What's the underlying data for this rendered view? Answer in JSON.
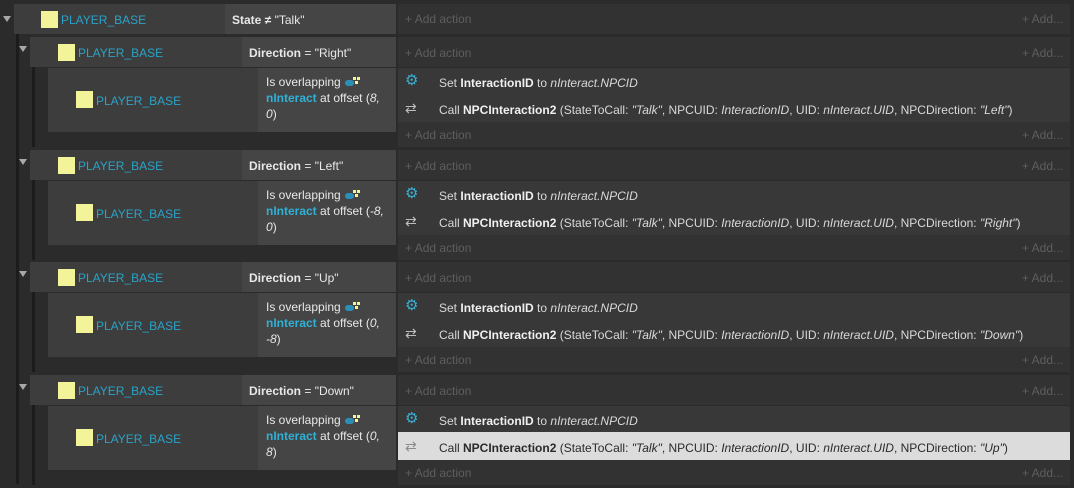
{
  "top": {
    "object": "PLAYER_BASE",
    "cond_prefix": "State ≠ ",
    "cond_value": "\"Talk\"",
    "add_action": "Add action",
    "add_right": "Add..."
  },
  "blocks": [
    {
      "object": "PLAYER_BASE",
      "dir_label": "Direction",
      "dir_value": "= \"Right\"",
      "sub_object": "PLAYER_BASE",
      "cond_l1": "Is overlapping",
      "cond_obj": "nInteract",
      "cond_l2a": " at offset (",
      "cond_l2b": "8,",
      "cond_l3": "0",
      "cond_l3end": ")",
      "a1_pre": "Set ",
      "a1_bold": "InteractionID",
      "a1_mid": " to ",
      "a1_ital": "nInteract.NPCID",
      "a2_pre": "Call ",
      "a2_bold": "NPCInteraction2",
      "a2_p1": " (StateToCall: ",
      "a2_i1": "\"Talk\"",
      "a2_p2": ", NPCUID: ",
      "a2_i2": "InteractionID",
      "a2_p3": ", UID: ",
      "a2_i3": "nInteract.UID",
      "a2_p4": ", NPCDirection: ",
      "a2_i4": "\"Left\"",
      "a2_p5": ")",
      "add_action": "Add action",
      "add_right": "Add..."
    },
    {
      "object": "PLAYER_BASE",
      "dir_label": "Direction",
      "dir_value": "= \"Left\"",
      "sub_object": "PLAYER_BASE",
      "cond_l1": "Is overlapping",
      "cond_obj": "nInteract",
      "cond_l2a": " at offset (",
      "cond_l2b": "-8,",
      "cond_l3": "0",
      "cond_l3end": ")",
      "a1_pre": "Set ",
      "a1_bold": "InteractionID",
      "a1_mid": " to ",
      "a1_ital": "nInteract.NPCID",
      "a2_pre": "Call ",
      "a2_bold": "NPCInteraction2",
      "a2_p1": " (StateToCall: ",
      "a2_i1": "\"Talk\"",
      "a2_p2": ", NPCUID: ",
      "a2_i2": "InteractionID",
      "a2_p3": ", UID: ",
      "a2_i3": "nInteract.UID",
      "a2_p4": ", NPCDirection: ",
      "a2_i4": "\"Right\"",
      "a2_p5": ")",
      "add_action": "Add action",
      "add_right": "Add..."
    },
    {
      "object": "PLAYER_BASE",
      "dir_label": "Direction",
      "dir_value": "= \"Up\"",
      "sub_object": "PLAYER_BASE",
      "cond_l1": "Is overlapping",
      "cond_obj": "nInteract",
      "cond_l2a": " at offset (",
      "cond_l2b": "0,",
      "cond_l3": "-8",
      "cond_l3end": ")",
      "a1_pre": "Set ",
      "a1_bold": "InteractionID",
      "a1_mid": " to ",
      "a1_ital": "nInteract.NPCID",
      "a2_pre": "Call ",
      "a2_bold": "NPCInteraction2",
      "a2_p1": " (StateToCall: ",
      "a2_i1": "\"Talk\"",
      "a2_p2": ", NPCUID: ",
      "a2_i2": "InteractionID",
      "a2_p3": ", UID: ",
      "a2_i3": "nInteract.UID",
      "a2_p4": ", NPCDirection: ",
      "a2_i4": "\"Down\"",
      "a2_p5": ")",
      "add_action": "Add action",
      "add_right": "Add..."
    },
    {
      "object": "PLAYER_BASE",
      "dir_label": "Direction",
      "dir_value": "= \"Down\"",
      "sub_object": "PLAYER_BASE",
      "cond_l1": "Is overlapping",
      "cond_obj": "nInteract",
      "cond_l2a": " at offset (",
      "cond_l2b": "0,",
      "cond_l3": "8",
      "cond_l3end": ")",
      "a1_pre": "Set ",
      "a1_bold": "InteractionID",
      "a1_mid": " to ",
      "a1_ital": "nInteract.NPCID",
      "a2_pre": "Call ",
      "a2_bold": "NPCInteraction2",
      "a2_p1": " (StateToCall: ",
      "a2_i1": "\"Talk\"",
      "a2_p2": ", NPCUID: ",
      "a2_i2": "InteractionID",
      "a2_p3": ", UID: ",
      "a2_i3": "nInteract.UID",
      "a2_p4": ", NPCDirection: ",
      "a2_i4": "\"Up\"",
      "a2_p5": ")",
      "add_action": "Add action",
      "add_right": "Add..."
    }
  ],
  "icons": {
    "expand": "triangle-down-icon",
    "object": "sprite-object-icon",
    "set": "gear-icon",
    "call": "function-call-icon",
    "add": "plus-icon"
  },
  "colors": {
    "object_name": "#29a3c9",
    "object_icon": "#f3f39a",
    "selected_row": "#dcdcdc"
  }
}
